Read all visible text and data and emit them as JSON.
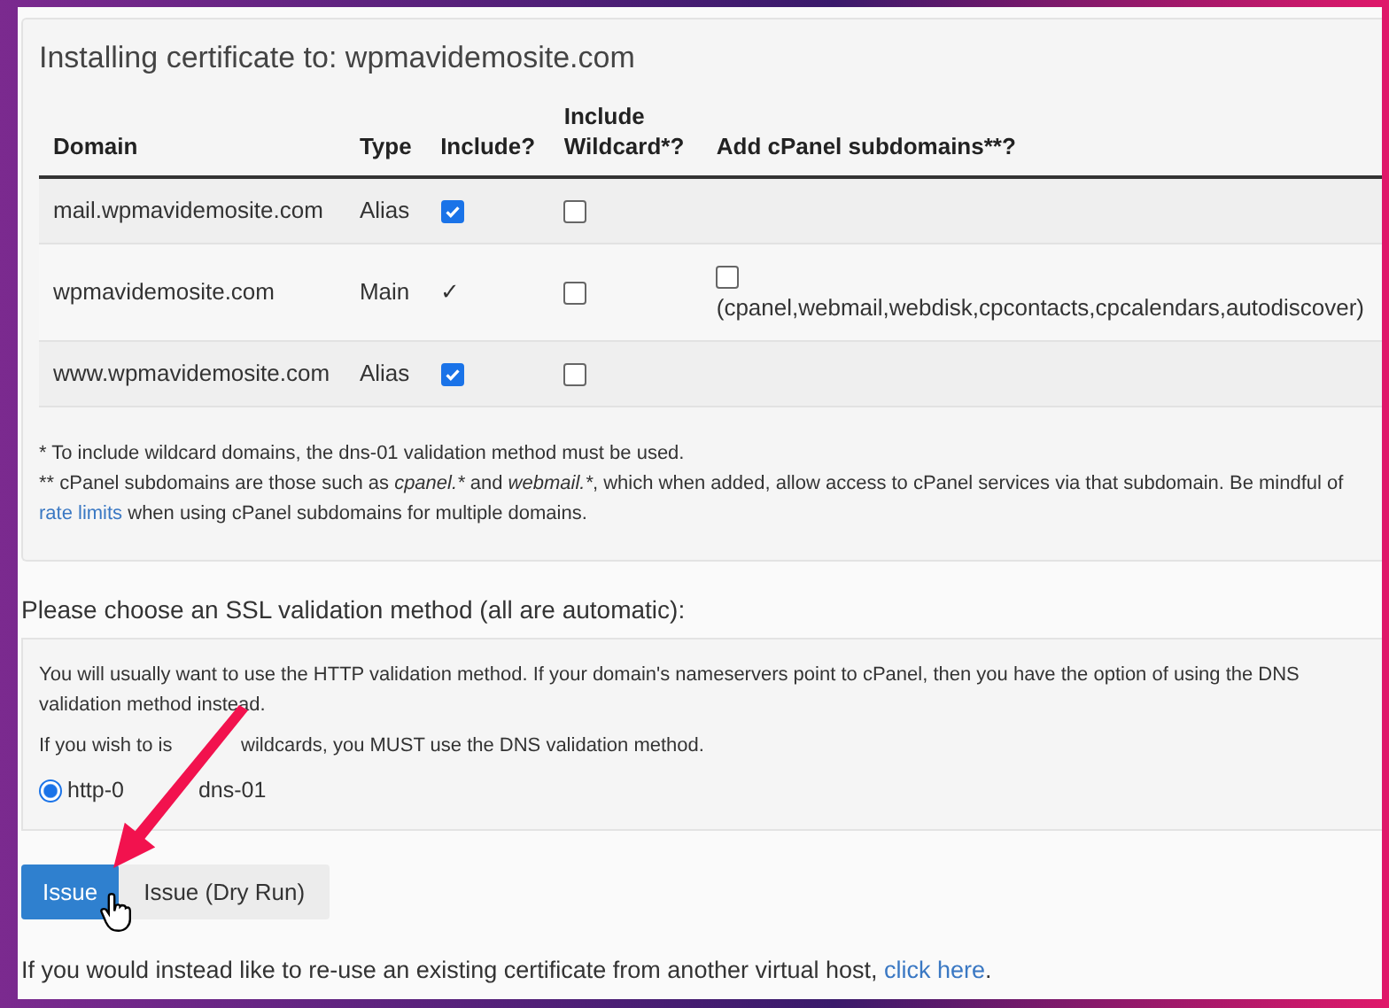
{
  "certificate_panel": {
    "title": "Installing certificate to: wpmavidemosite.com",
    "columns": [
      "Domain",
      "Type",
      "Include?",
      "Include Wildcard*?",
      "Add cPanel subdomains**?"
    ],
    "rows": [
      {
        "domain": "mail.wpmavidemosite.com",
        "type": "Alias",
        "include_checked": true,
        "wildcard_checked": false
      },
      {
        "domain": "wpmavidemosite.com",
        "type": "Main",
        "include_checked": true,
        "include_mark": "✓",
        "wildcard_checked": false,
        "subdomains": {
          "checked": false,
          "label": "(cpanel,webmail,webdisk,cpcontacts,cpcalendars,autodiscover)"
        }
      },
      {
        "domain": "www.wpmavidemosite.com",
        "type": "Alias",
        "include_checked": true,
        "wildcard_checked": false
      }
    ],
    "note_1": "* To include wildcard domains, the dns-01 validation method must be used.",
    "note_2": [
      {
        "text": "** cPanel subdomains are those such as ",
        "italic": false
      },
      {
        "text": "cpanel.*",
        "italic": true
      },
      {
        "text": " and ",
        "italic": false
      },
      {
        "text": "webmail.*",
        "italic": true
      },
      {
        "text": ", which when added, allow access to cPanel services via that subdomain. Be mindful of",
        "italic": false
      }
    ],
    "note_link": "rate limits",
    "note_tail": "when using cPanel subdomains for multiple domains."
  },
  "validation": {
    "heading": "Please choose an SSL validation method (all are automatic):",
    "info": "You will usually want to use the HTTP validation method. If your domain's nameservers point to cPanel, then you have the option of using the DNS validation method instead.",
    "wildcard_before": "If you wish to is",
    "wildcard_after": "wildcards, you MUST use the DNS validation method.",
    "options": [
      {
        "label": "http-0",
        "selected": true
      },
      {
        "label": "dns-01",
        "selected": false
      }
    ]
  },
  "buttons": [
    {
      "label": "Issue",
      "kind": "primary"
    },
    {
      "label": "Issue (Dry Run)",
      "kind": "secondary"
    }
  ],
  "reuse": {
    "text": "If you would instead like to re-use an existing certificate from another virtual host,",
    "link": "click here",
    "tail": "."
  }
}
